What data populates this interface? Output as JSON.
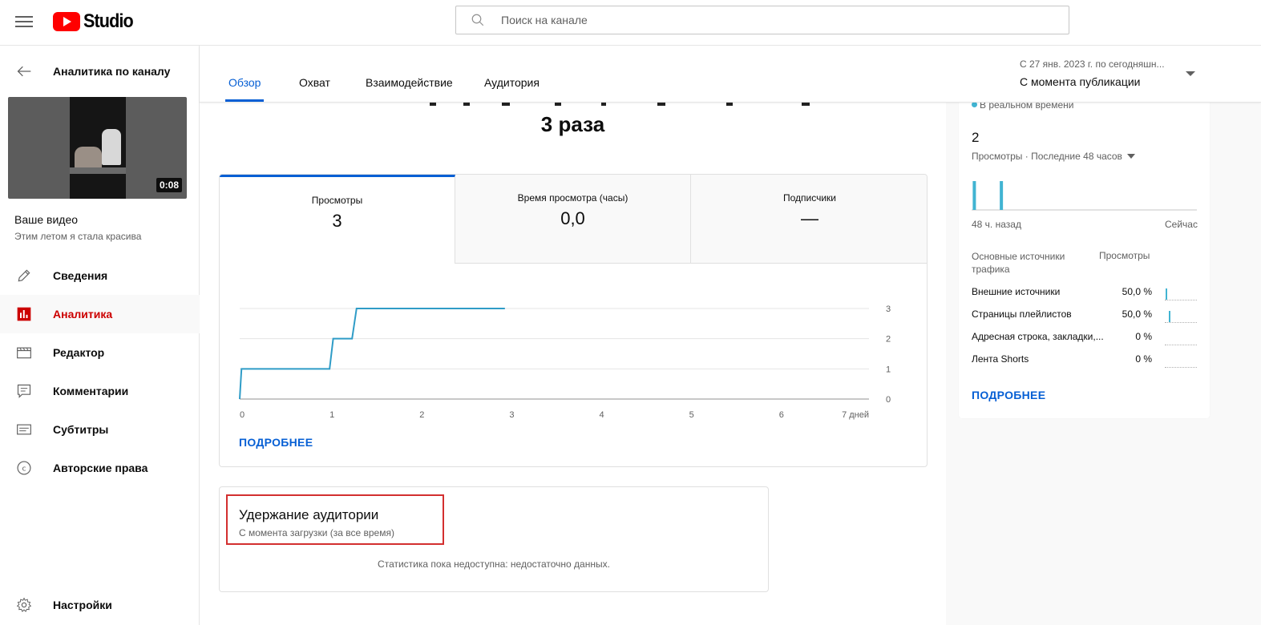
{
  "app": {
    "logo_text": "Studio",
    "search": {
      "placeholder": "Поиск на канале"
    }
  },
  "sidebar": {
    "back_label": "Аналитика по каналу",
    "video": {
      "duration": "0:08",
      "your_video_label": "Ваше видео",
      "title": "Этим летом я стала красива"
    },
    "items": [
      {
        "label": "Сведения",
        "icon": "pencil-icon",
        "active": false
      },
      {
        "label": "Аналитика",
        "icon": "analytics-icon",
        "active": true
      },
      {
        "label": "Редактор",
        "icon": "editor-icon",
        "active": false
      },
      {
        "label": "Комментарии",
        "icon": "comments-icon",
        "active": false
      },
      {
        "label": "Субтитры",
        "icon": "subtitles-icon",
        "active": false
      },
      {
        "label": "Авторские права",
        "icon": "copyright-icon",
        "active": false
      }
    ],
    "settings_label": "Настройки"
  },
  "tabs": [
    {
      "label": "Обзор",
      "active": true
    },
    {
      "label": "Охват",
      "active": false
    },
    {
      "label": "Взаимодействие",
      "active": false
    },
    {
      "label": "Аудитория",
      "active": false
    }
  ],
  "date_range": {
    "range_text": "С 27 янв. 2023 г. по сегодняшн...",
    "label": "С момента публикации"
  },
  "headline": "3 раза",
  "metrics": [
    {
      "label": "Просмотры",
      "value": "3",
      "active": true
    },
    {
      "label": "Время просмотра (часы)",
      "value": "0,0",
      "active": false
    },
    {
      "label": "Подписчики",
      "value": "—",
      "active": false
    }
  ],
  "chart_data": {
    "type": "line",
    "x_tick_labels": [
      "0",
      "1",
      "2",
      "3",
      "4",
      "5",
      "6",
      "7 дней"
    ],
    "y_tick_labels": [
      "0",
      "1",
      "2",
      "3"
    ],
    "xlim": [
      0,
      7
    ],
    "ylim": [
      0,
      3
    ],
    "grid": true,
    "series": [
      {
        "points": [
          [
            0,
            0
          ],
          [
            0.02,
            1
          ],
          [
            1.0,
            1
          ],
          [
            1.04,
            2
          ],
          [
            1.25,
            2
          ],
          [
            1.3,
            3
          ],
          [
            2.95,
            3
          ]
        ]
      }
    ],
    "color": "#2f9cc7"
  },
  "more_label": "ПОДРОБНЕЕ",
  "retention": {
    "title": "Удержание аудитории",
    "subtitle": "С момента загрузки (за все время)",
    "empty_text": "Статистика пока недоступна: недостаточно данных."
  },
  "realtime": {
    "label": "В реальном времени",
    "count": "2",
    "description": "Просмотры · Последние 48 часов",
    "axis_left": "48 ч. назад",
    "axis_right": "Сейчас",
    "bars": [
      {
        "position_fraction": 0.005,
        "value": 1
      },
      {
        "position_fraction": 0.125,
        "value": 1
      }
    ],
    "bar_color": "#41b4d2"
  },
  "traffic_sources": {
    "header_source": "Основные источники трафика",
    "header_views": "Просмотры",
    "rows": [
      {
        "name": "Внешние источники",
        "percent": "50,0 %",
        "bar_fraction": 0.02
      },
      {
        "name": "Страницы плейлистов",
        "percent": "50,0 %",
        "bar_fraction": 0.12
      },
      {
        "name": "Адресная строка, закладки,...",
        "percent": "0 %",
        "bar_fraction": null
      },
      {
        "name": "Лента Shorts",
        "percent": "0 %",
        "bar_fraction": null
      }
    ],
    "more_label": "ПОДРОБНЕЕ"
  }
}
